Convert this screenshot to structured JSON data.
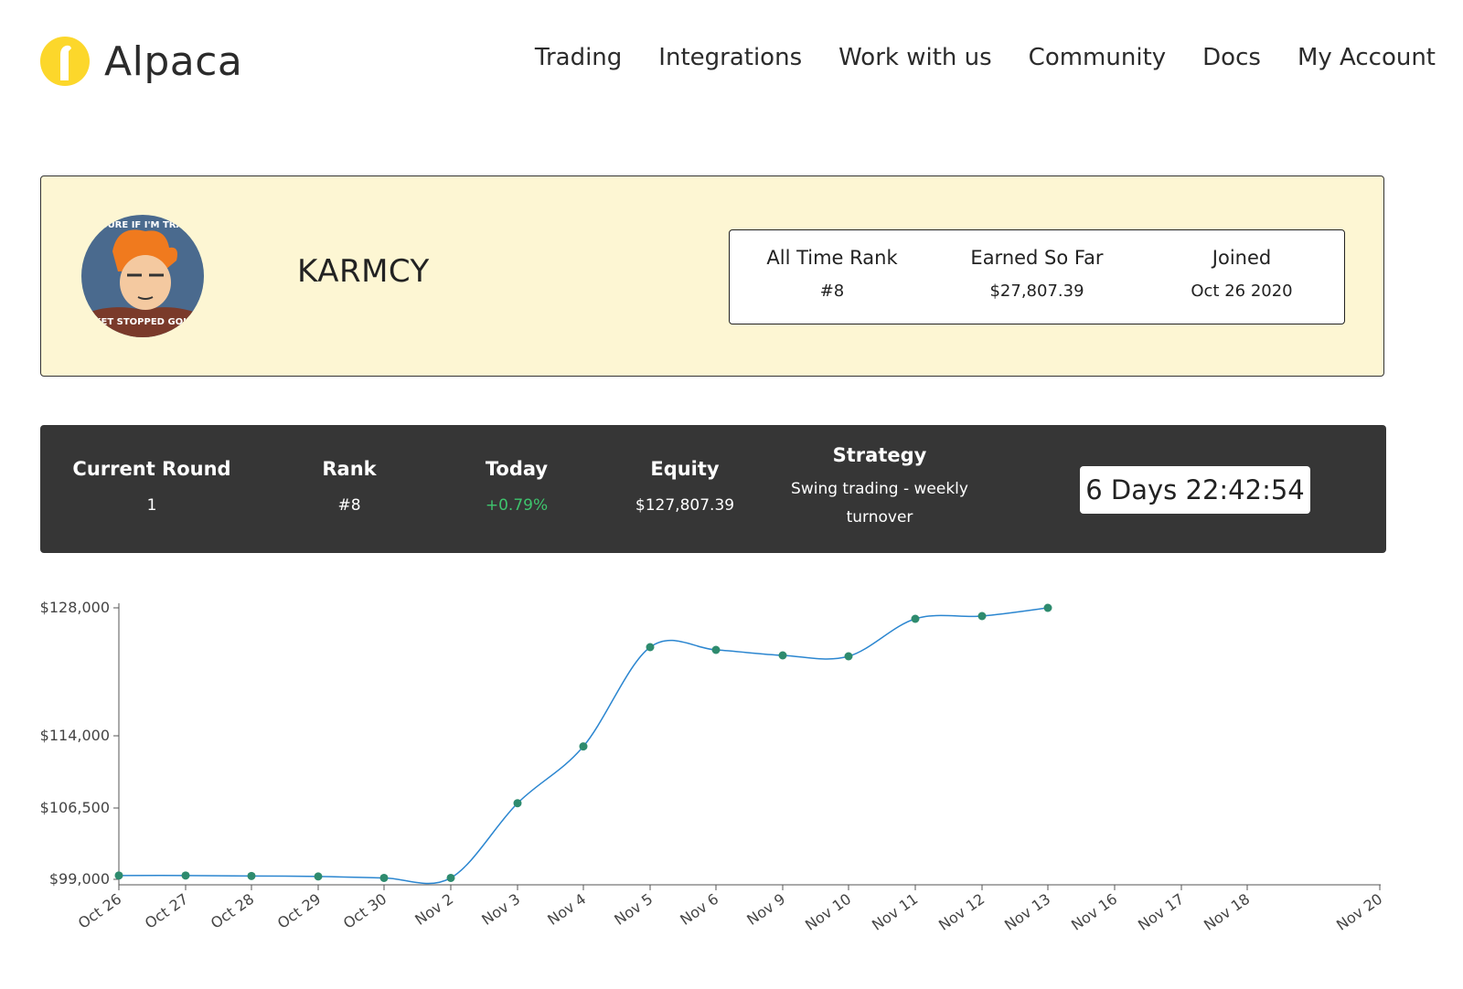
{
  "brand": {
    "name": "Alpaca",
    "color": "#fcd72b",
    "icon": "alpaca-logo-icon"
  },
  "nav": [
    {
      "label": "Trading"
    },
    {
      "label": "Integrations"
    },
    {
      "label": "Work with us"
    },
    {
      "label": "Community"
    },
    {
      "label": "Docs"
    },
    {
      "label": "My Account"
    }
  ],
  "profile": {
    "username": "KARMCY",
    "avatar_top_text": "NOT SURE IF I'M TRADING",
    "avatar_bottom_text": "THE MARKET STOPPED GOING DOWN",
    "all_time_rank_label": "All Time Rank",
    "all_time_rank": "#8",
    "earned_label": "Earned So Far",
    "earned": "$27,807.39",
    "joined_label": "Joined",
    "joined": "Oct 26 2020"
  },
  "round": {
    "current_round_label": "Current Round",
    "current_round": "1",
    "rank_label": "Rank",
    "rank": "#8",
    "today_label": "Today",
    "today": "+0.79%",
    "today_color": "#3ec46d",
    "equity_label": "Equity",
    "equity": "$127,807.39",
    "strategy_label": "Strategy",
    "strategy": "Swing trading - weekly turnover",
    "countdown": "6 Days 22:42:54"
  },
  "chart_data": {
    "type": "line",
    "x_ticks": [
      "Oct 26",
      "Oct 27",
      "Oct 28",
      "Oct 29",
      "Oct 30",
      "Nov 2",
      "Nov 3",
      "Nov 4",
      "Nov 5",
      "Nov 6",
      "Nov 9",
      "Nov 10",
      "Nov 11",
      "Nov 12",
      "Nov 13",
      "Nov 16",
      "Nov 17",
      "Nov 18",
      "Nov 20"
    ],
    "y_ticks": [
      "$128,000",
      "$114,000",
      "$106,500",
      "$99,000"
    ],
    "y_tick_values": [
      128000,
      114000,
      106500,
      99000
    ],
    "line_color": "#2b86d0",
    "point_color": "#2e8b6e",
    "series": [
      {
        "values": [
          99400,
          99400,
          99350,
          99300,
          99150,
          99150,
          107000,
          112900,
          123700,
          123400,
          122800,
          122700,
          126800,
          127100,
          128000
        ]
      }
    ]
  }
}
